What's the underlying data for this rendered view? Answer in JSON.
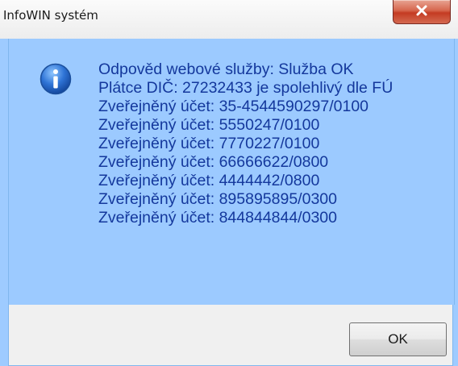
{
  "window": {
    "title": "InfoWIN systém",
    "close_icon": "close-icon"
  },
  "message": {
    "icon": "info-icon",
    "lines": [
      "Odpověd webové služby: Služba OK",
      "Plátce DIČ: 27232433 je spolehlivý dle FÚ",
      "Zveřejněný účet: 35-4544590297/0100",
      "Zveřejněný účet: 5550247/0100",
      "Zveřejněný účet: 7770227/0100",
      "Zveřejněný účet: 66666622/0800",
      "Zveřejněný účet: 4444442/0800",
      "Zveřejněný účet: 895895895/0300",
      "Zveřejněný účet: 844844844/0300"
    ]
  },
  "buttons": {
    "ok_label": "OK"
  },
  "colors": {
    "content_background": "#9ccaff",
    "message_text": "#14389c",
    "close_button": "#c43b22"
  }
}
